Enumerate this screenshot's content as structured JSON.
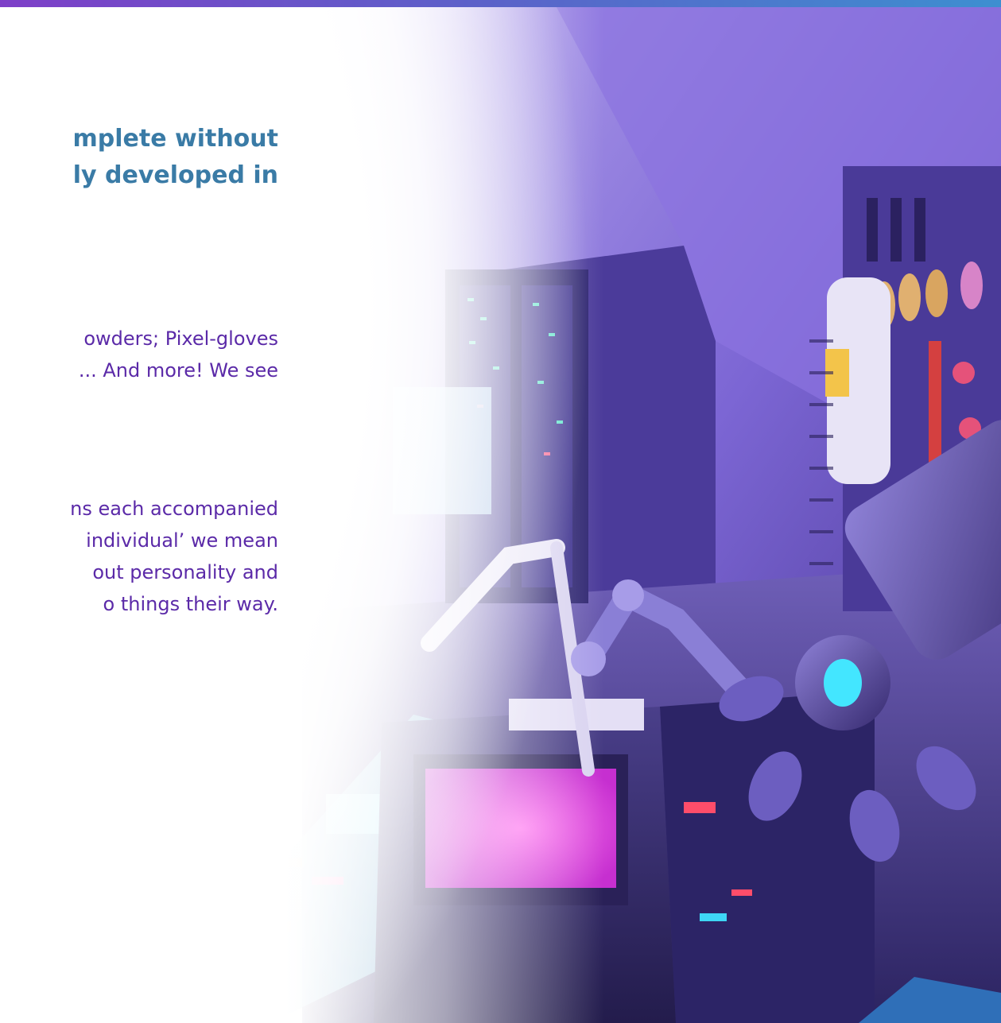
{
  "headline": {
    "line1": "mplete without",
    "line2": "ly developed in"
  },
  "paragraph1": {
    "line1": "owders; Pixel-gloves",
    "line2": "... And more! We see"
  },
  "paragraph2": {
    "line1": "ns each accompanied",
    "line2": "individual’ we mean",
    "line3": "out personality and",
    "line4": "o things their way."
  },
  "colors": {
    "headline": "#3a7ba6",
    "body_text": "#5b2aa8",
    "top_bar_start": "#7e3fc8",
    "top_bar_end": "#3d8fd0"
  },
  "illustration": {
    "subject": "robot-lab-workshop",
    "icons": [
      "robot-arm-icon",
      "tool-rack-icon",
      "server-rack-icon",
      "control-panel-icon"
    ]
  }
}
